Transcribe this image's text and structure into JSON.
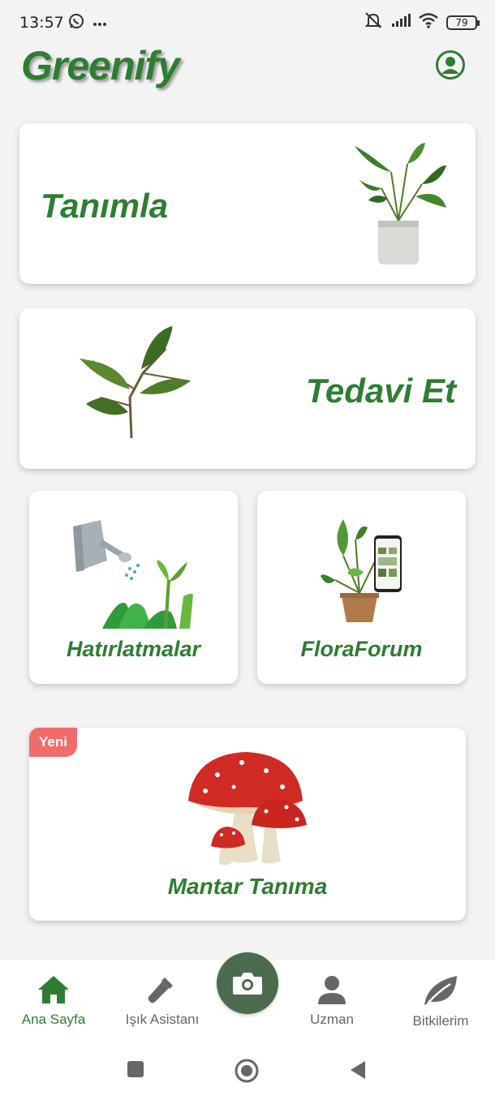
{
  "status_bar": {
    "time": "13:57",
    "battery": "79",
    "icons": [
      "whatsapp-icon",
      "more-dots-icon",
      "mute-icon",
      "signal-icon",
      "wifi-icon",
      "battery-icon"
    ]
  },
  "header": {
    "title": "Greenify",
    "profile_icon": "account-circle-icon"
  },
  "cards": {
    "identify": {
      "label": "Tanımla",
      "image": "potted-plant"
    },
    "treat": {
      "label": "Tedavi Et",
      "image": "leaf-branch"
    },
    "reminders": {
      "label": "Hatırlatmalar",
      "image": "watering-can"
    },
    "forum": {
      "label": "FloraForum",
      "image": "plant-with-phone"
    },
    "mushroom": {
      "label": "Mantar Tanıma",
      "badge": "Yeni",
      "image": "mushrooms"
    }
  },
  "bottom_nav": {
    "items": [
      {
        "label": "Ana Sayfa",
        "icon": "home-icon",
        "active": true
      },
      {
        "label": "Işık Asistanı",
        "icon": "flashlight-icon",
        "active": false
      },
      {
        "label": "Uzman",
        "icon": "person-icon",
        "active": false
      },
      {
        "label": "Bitkilerim",
        "icon": "leaf-icon",
        "active": false
      }
    ],
    "camera_icon": "camera-icon"
  },
  "colors": {
    "primary": "#2e7d32",
    "camera_button": "#4a6b4c",
    "badge": "#f26b6b",
    "background": "#f3f3f3"
  }
}
